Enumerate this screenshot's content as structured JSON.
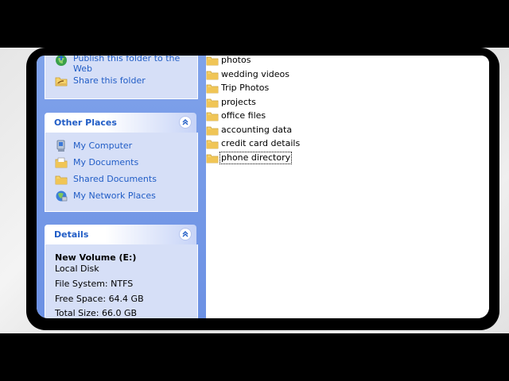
{
  "sidebar": {
    "file_tasks": {
      "items": [
        {
          "label_line1": "Publish this folder to the",
          "label_line2": "Web",
          "icon": "publish-globe-icon"
        },
        {
          "label": "Share this folder",
          "icon": "share-folder-icon"
        }
      ]
    },
    "other_places": {
      "title": "Other Places",
      "items": [
        {
          "label": "My Computer",
          "icon": "my-computer-icon"
        },
        {
          "label": "My Documents",
          "icon": "my-documents-icon"
        },
        {
          "label": "Shared Documents",
          "icon": "shared-documents-icon"
        },
        {
          "label": "My Network Places",
          "icon": "network-places-icon"
        }
      ]
    },
    "details": {
      "title": "Details",
      "name": "New Volume (E:)",
      "type": "Local Disk",
      "file_system": "File System: NTFS",
      "free_space": "Free Space: 64.4 GB",
      "total_size": "Total Size: 66.0 GB"
    }
  },
  "files": {
    "items": [
      "photos",
      "wedding videos",
      "Trip Photos",
      "projects",
      "office files",
      "accounting data",
      "credit card details",
      "phone directory"
    ],
    "selected": "phone directory"
  },
  "colors": {
    "sidebar_bg": "#7fa2ea",
    "panel_bg": "#d6dff7",
    "link": "#215dc6",
    "folder": "#f5d36b"
  }
}
